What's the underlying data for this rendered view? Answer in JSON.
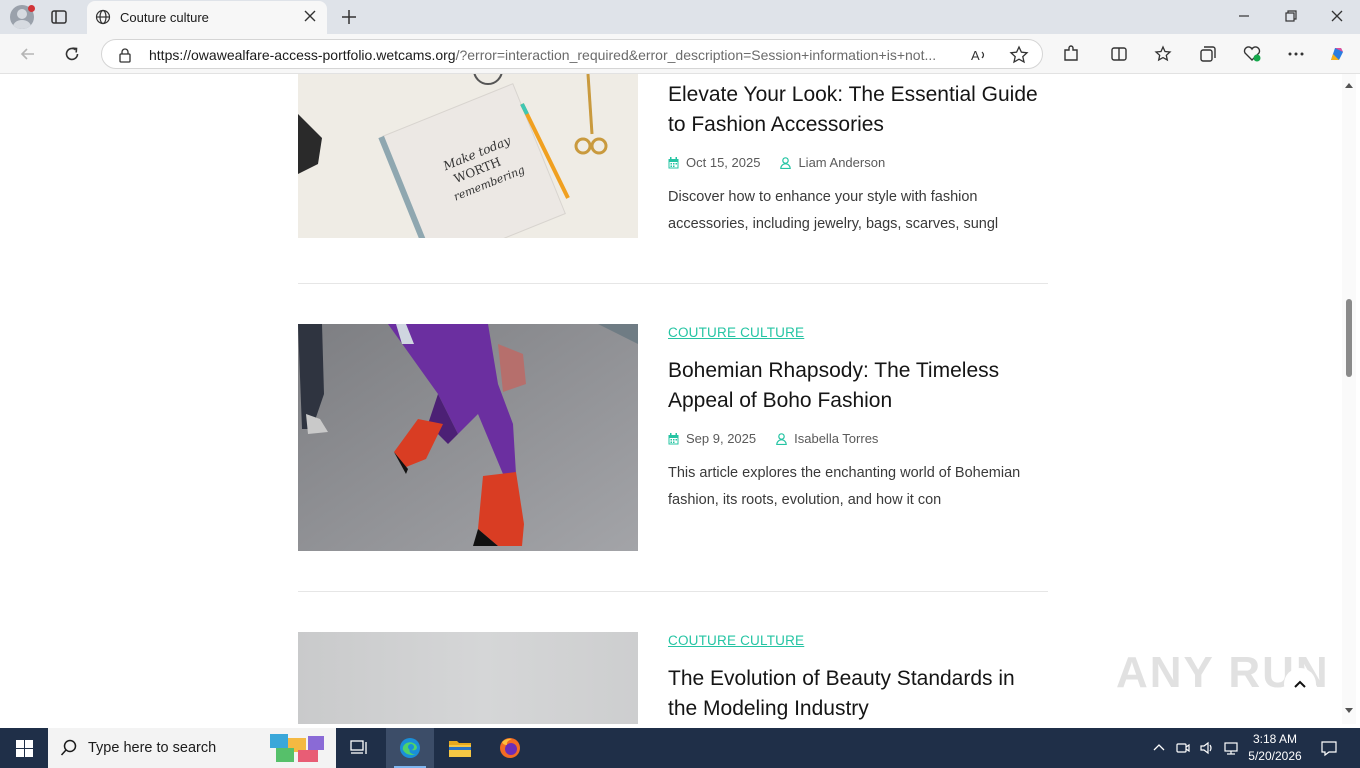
{
  "browser": {
    "tab_title": "Couture culture",
    "url_host": "https://owawealfare-access-portfolio.wetcams.org",
    "url_rest": "/?error=interaction_required&error_description=Session+information+is+not..."
  },
  "articles": [
    {
      "category": "",
      "title": "Elevate Your Look: The Essential Guide to Fashion Accessories",
      "date": "Oct 15, 2025",
      "author": "Liam Anderson",
      "excerpt": "Discover how to enhance your style with fashion accessories, including jewelry, bags, scarves, sungl"
    },
    {
      "category": "COUTURE CULTURE",
      "title": "Bohemian Rhapsody: The Timeless Appeal of Boho Fashion",
      "date": "Sep 9, 2025",
      "author": "Isabella Torres",
      "excerpt": "This article explores the enchanting world of Bohemian fashion, its roots, evolution, and how it con"
    },
    {
      "category": "COUTURE CULTURE",
      "title": "The Evolution of Beauty Standards in the Modeling Industry"
    }
  ],
  "image_text": "Make today WORTH remembering",
  "watermark": "ANY RUN",
  "taskbar": {
    "search_placeholder": "Type here to search",
    "time": "3:18 AM",
    "date": "5/20/2026"
  },
  "colors": {
    "accent": "#25c4a3",
    "taskbar": "#1f2f48"
  }
}
